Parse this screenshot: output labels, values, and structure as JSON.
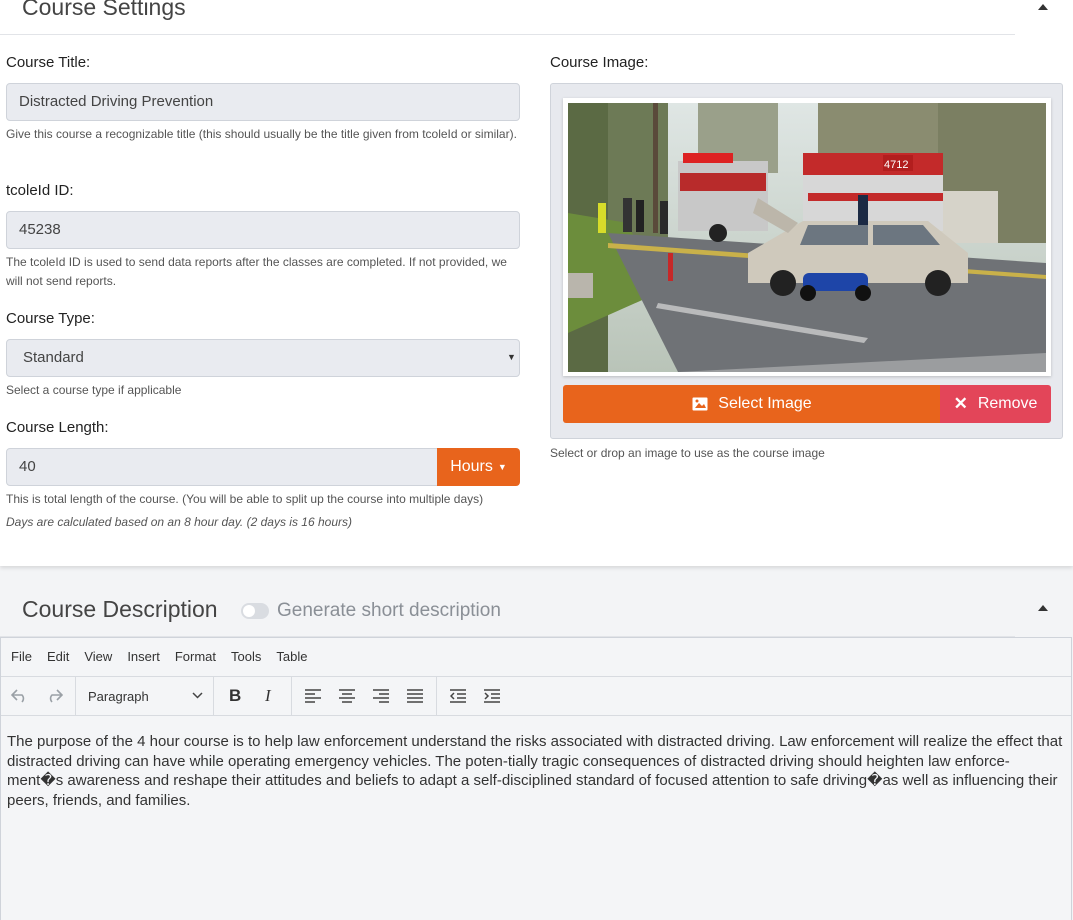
{
  "settings": {
    "title": "Course Settings",
    "course_title": {
      "label": "Course Title:",
      "value": "Distracted Driving Prevention",
      "help": "Give this course a recognizable title (this should usually be the title given from tcoleId or similar)."
    },
    "tcole_id": {
      "label": "tcoleId ID:",
      "value": "45238",
      "help": "The tcoleId ID is used to send data reports after the classes are completed. If not provided, we will not send reports."
    },
    "course_type": {
      "label": "Course Type:",
      "value": "Standard",
      "help": "Select a course type if applicable"
    },
    "course_length": {
      "label": "Course Length:",
      "value": "40",
      "unit": "Hours",
      "help": "This is total length of the course. (You will be able to split up the course into multiple days)",
      "note": "Days are calculated based on an 8 hour day. (2 days is 16 hours)"
    },
    "course_image": {
      "label": "Course Image:",
      "select_label": "Select Image",
      "remove_label": "Remove",
      "help": "Select or drop an image to use as the course image",
      "truck_number": "4712"
    }
  },
  "description": {
    "title": "Course Description",
    "toggle_label": "Generate short description",
    "menu": [
      "File",
      "Edit",
      "View",
      "Insert",
      "Format",
      "Tools",
      "Table"
    ],
    "block_format": "Paragraph",
    "content": "The purpose of the 4 hour course is to help law enforcement understand the risks associated with distracted driving. Law enforcement will realize the effect that distracted driving can have while operating emergency vehicles. The poten-tially tragic consequences of distracted driving should heighten law enforce-ment�s awareness and reshape their attitudes and beliefs to adapt a self-disciplined standard of focused attention to safe driving�as well as influencing their peers, friends, and families."
  },
  "colors": {
    "accent": "#e8641c",
    "danger": "#e34559",
    "field_bg": "#e9ebf0"
  }
}
